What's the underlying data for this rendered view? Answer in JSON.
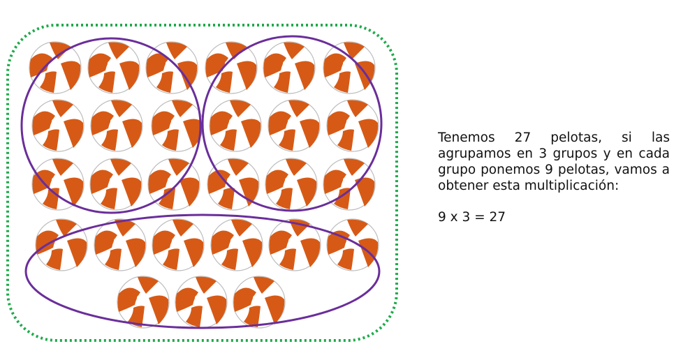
{
  "explanation": {
    "text": "Tenemos 27 pelotas, si las agrupamos en 3 grupos y en cada grupo ponemos 9 pelotas, vamos a obtener esta multiplicación:",
    "equation": "9 x 3 = 27"
  },
  "figure": {
    "total_balls": 27,
    "groups": 3,
    "balls_per_group": 9,
    "ball_icon": "beach-ball-icon",
    "colors": {
      "ball_stripe": "#d65a16",
      "ball_base": "#ffffff",
      "ball_outline": "#bdbdbd",
      "group_outline": "#6a2e9a",
      "frame_outline": "#1faa4b"
    }
  }
}
